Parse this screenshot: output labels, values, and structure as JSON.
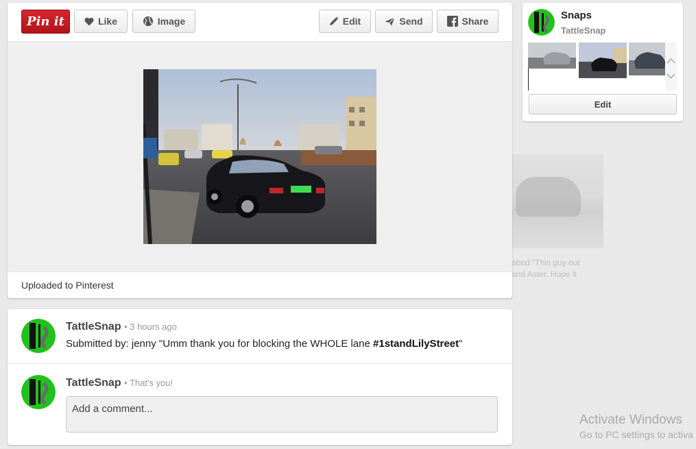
{
  "toolbar": {
    "pin_label": "Pin it",
    "like_label": "Like",
    "image_label": "Image",
    "edit_label": "Edit",
    "send_label": "Send",
    "share_label": "Share"
  },
  "pin": {
    "source_text": "Uploaded to Pinterest"
  },
  "board": {
    "name": "Snaps",
    "owner": "TattleSnap",
    "edit_label": "Edit"
  },
  "comments": [
    {
      "author": "TattleSnap",
      "meta": "• 3 hours ago",
      "text_prefix": "Submitted by: jenny \"Umm thank you for blocking the WHOLE lane ",
      "hashtag": "#1standLilyStreet",
      "text_suffix": "\""
    }
  ],
  "compose": {
    "author": "TattleSnap",
    "meta": "• That's you!",
    "placeholder": "Add a comment..."
  },
  "background": {
    "text_line1": "abed \"This guy out",
    "text_line2": "and Aster. Hope it"
  },
  "watermark": {
    "line1": "Activate Windows",
    "line2": "Go to PC settings to activa"
  },
  "colors": {
    "pin_red": "#c8232c",
    "avatar_green": "#22c21c",
    "page_bg": "#e9e9e9"
  }
}
